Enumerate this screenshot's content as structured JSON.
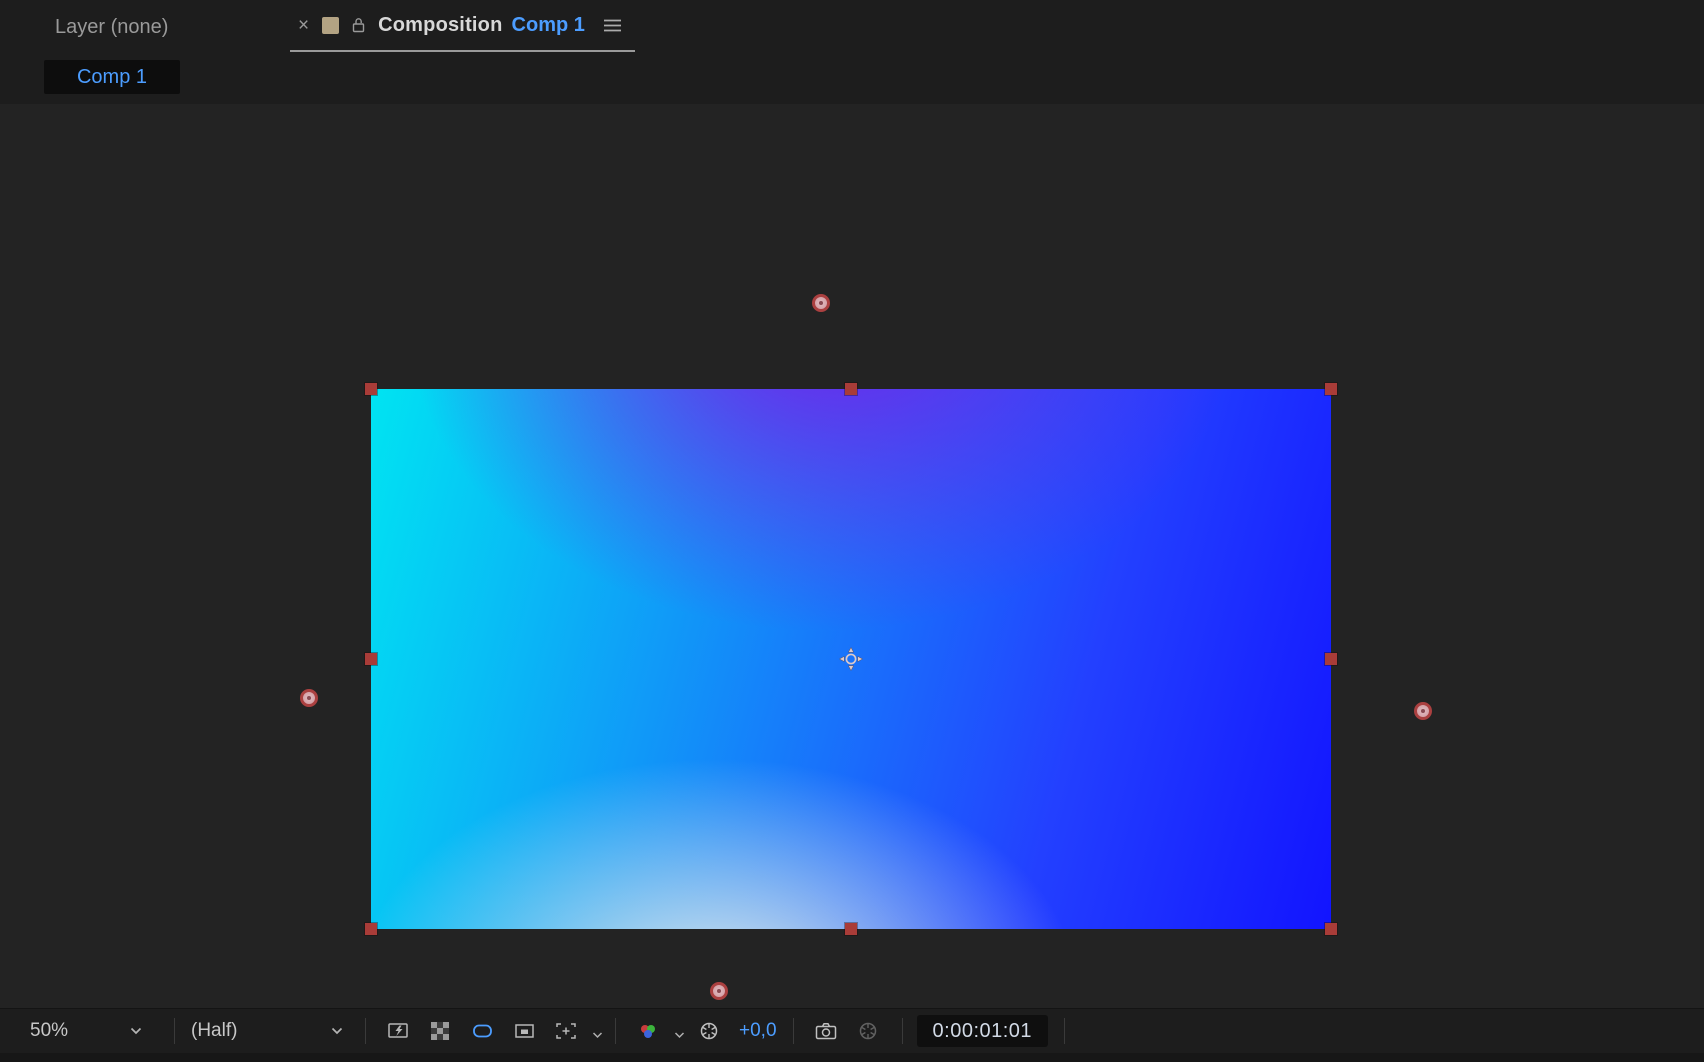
{
  "panel": {
    "inactive_tab": "Layer (none)",
    "active_tab": {
      "close_label": "×",
      "title": "Composition",
      "comp_name": "Comp 1"
    },
    "comp_selector": "Comp 1"
  },
  "toolbar": {
    "zoom_value": "50%",
    "resolution_value": "(Half)",
    "exposure_value": "+0,0",
    "timecode": "0:00:01:01",
    "icon_names": [
      "fast-previews",
      "transparency-grid",
      "mask-and-shape-path-visibility",
      "region-of-interest",
      "grid-and-guide-options",
      "channel-settings",
      "adjust-exposure",
      "take-snapshot",
      "show-snapshot"
    ]
  },
  "viewport": {
    "selection_handles": [
      "top-left",
      "top-center",
      "top-right",
      "mid-left",
      "mid-right",
      "bottom-left",
      "bottom-center",
      "bottom-right"
    ],
    "effect_control_points": [
      "top",
      "left",
      "right",
      "bottom"
    ],
    "anchor_point": "center"
  },
  "colors": {
    "accent_blue": "#4c9dff",
    "selection_red": "#a93c38",
    "gradient_top": "#7a1ae8",
    "gradient_left": "#00e4f2",
    "gradient_right": "#1214ff",
    "gradient_bottom": "#e8f0ea",
    "panel_bg": "#1d1d1d",
    "viewport_bg": "#232323",
    "tab_swatch": "#b3a383"
  }
}
